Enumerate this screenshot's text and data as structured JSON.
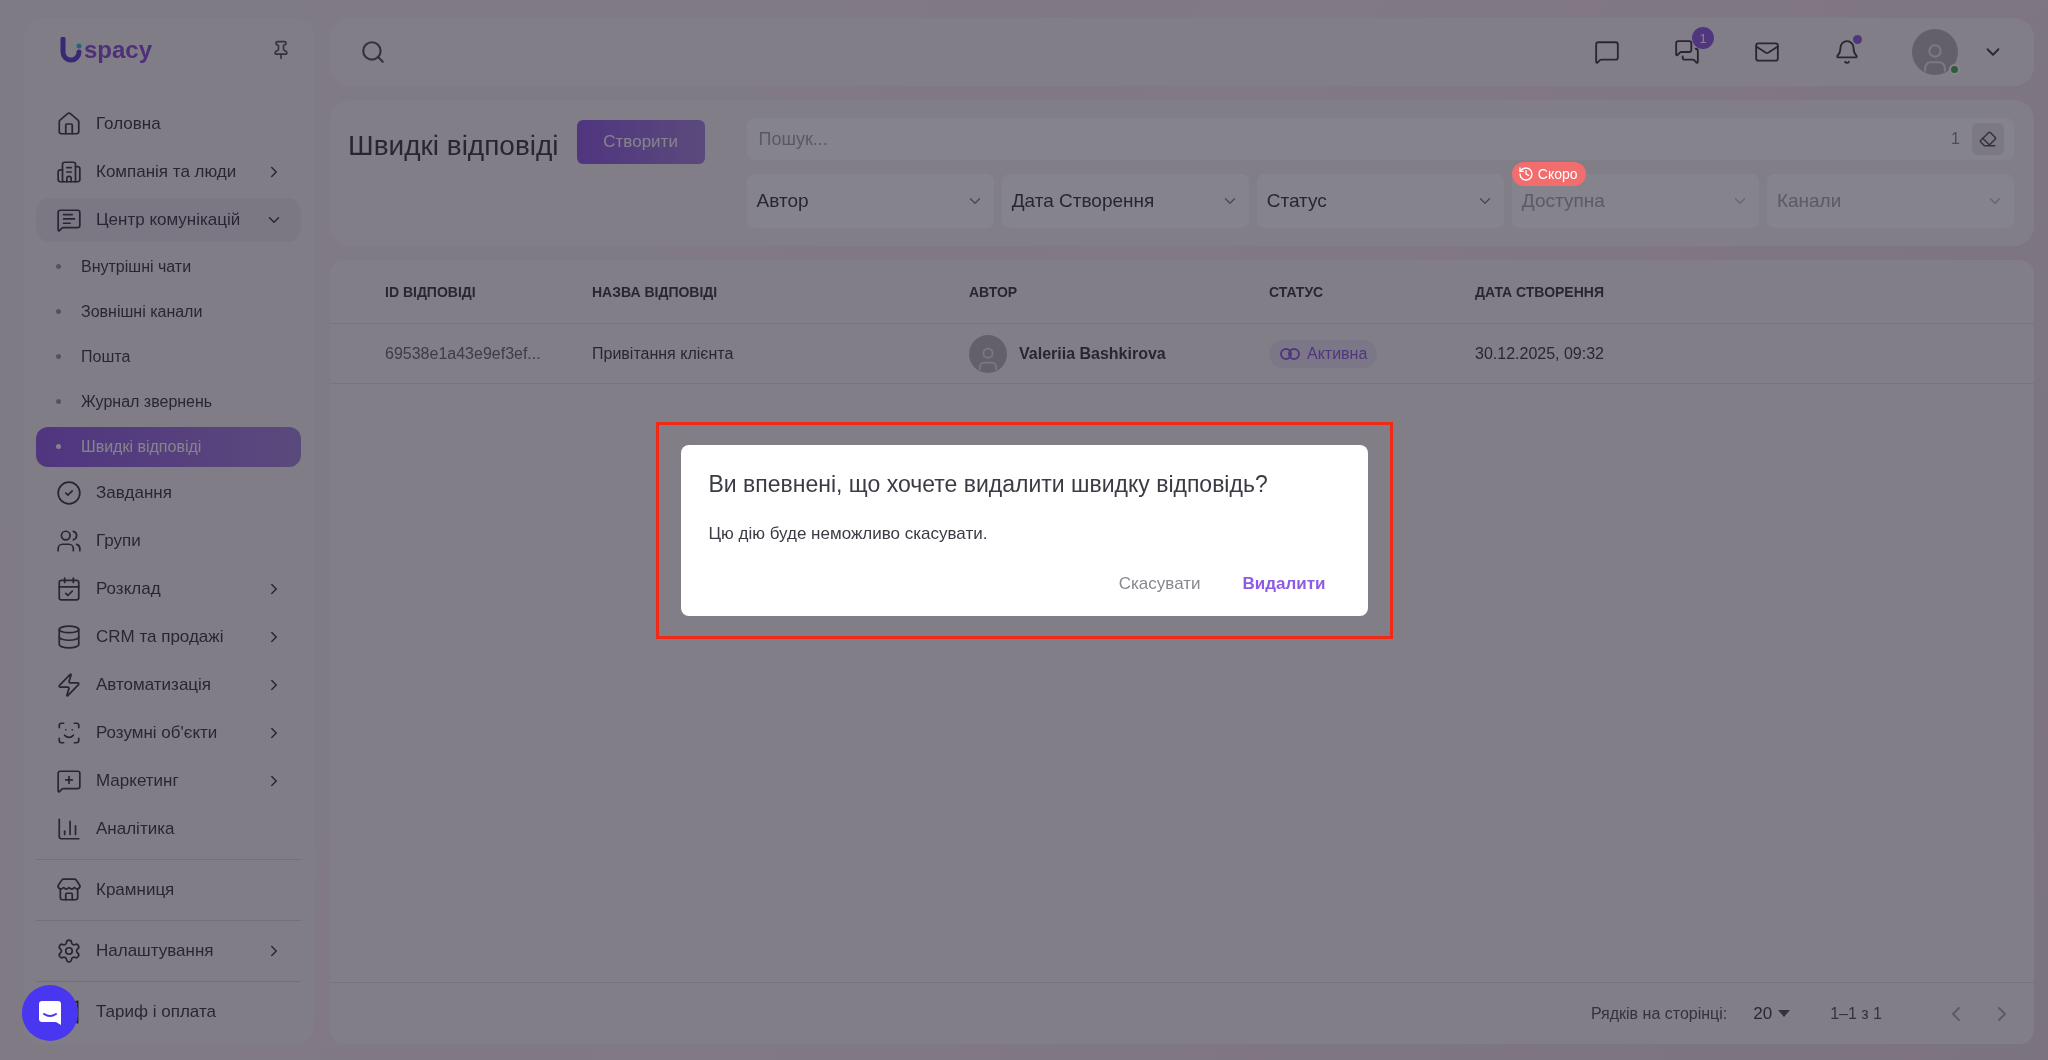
{
  "sidebar": {
    "logo": "spacy",
    "sections": [
      {
        "items": [
          {
            "label": "Головна",
            "has_submenu": false
          },
          {
            "label": "Компанія та люди",
            "has_submenu": true,
            "expanded": false
          },
          {
            "label": "Центр комунікацій",
            "has_submenu": true,
            "expanded": true,
            "children": [
              {
                "label": "Внутрішні чати",
                "selected": false
              },
              {
                "label": "Зовнішні канали",
                "selected": false
              },
              {
                "label": "Пошта",
                "selected": false
              },
              {
                "label": "Журнал звернень",
                "selected": false
              },
              {
                "label": "Швидкі відповіді",
                "selected": true
              }
            ]
          },
          {
            "label": "Завдання",
            "has_submenu": false
          },
          {
            "label": "Групи",
            "has_submenu": false
          },
          {
            "label": "Розклад",
            "has_submenu": true,
            "expanded": false
          },
          {
            "label": "CRM та продажі",
            "has_submenu": true,
            "expanded": false
          },
          {
            "label": "Автоматизація",
            "has_submenu": true,
            "expanded": false
          },
          {
            "label": "Розумні об'єкти",
            "has_submenu": true,
            "expanded": false
          },
          {
            "label": "Маркетинг",
            "has_submenu": true,
            "expanded": false
          },
          {
            "label": "Аналітика",
            "has_submenu": false
          }
        ]
      },
      {
        "items": [
          {
            "label": "Крамниця",
            "has_submenu": false
          }
        ]
      },
      {
        "items": [
          {
            "label": "Налаштування",
            "has_submenu": true,
            "expanded": false
          }
        ]
      },
      {
        "items": [
          {
            "label": "Тариф і оплата",
            "has_submenu": false
          }
        ]
      }
    ]
  },
  "top_bar": {
    "icons": [
      {
        "dot": false
      },
      {
        "badge": "1",
        "dot": false
      },
      {
        "dot": false
      },
      {
        "dot": true
      }
    ],
    "user": {
      "online": true
    }
  },
  "page": {
    "title": "Швидкі відповіді",
    "create_button": "Створити",
    "search": {
      "placeholder": "Пошук...",
      "count": "1"
    },
    "filters": [
      {
        "label": "Автор",
        "disabled": false
      },
      {
        "label": "Дата Створення",
        "disabled": false
      },
      {
        "label": "Статус",
        "disabled": false
      },
      {
        "label": "Доступна",
        "disabled": true,
        "badge": "Скоро"
      },
      {
        "label": "Канали",
        "disabled": true
      }
    ]
  },
  "table": {
    "columns": [
      "ID ВІДПОВІДІ",
      "НАЗВА ВІДПОВІДІ",
      "АВТОР",
      "СТАТУС",
      "ДАТА СТВОРЕННЯ"
    ],
    "rows": [
      {
        "id": "69538e1a43e9ef3ef...",
        "name": "Привітання клієнта",
        "author": "Valeriia Bashkirova",
        "status": "Активна",
        "created": "30.12.2025, 09:32"
      }
    ],
    "footer": {
      "rows_per_page_label": "Рядків на сторінці:",
      "rows_per_page": "20",
      "range": "1–1 з 1"
    }
  },
  "dialog": {
    "highlighted": true,
    "title": "Ви впевнені, що хочете видалити швидку відповідь?",
    "message": "Цю дію буде неможливо скасувати.",
    "buttons": [
      {
        "label": "Скасувати",
        "kind": "secondary"
      },
      {
        "label": "Видалити",
        "kind": "primary"
      }
    ]
  }
}
